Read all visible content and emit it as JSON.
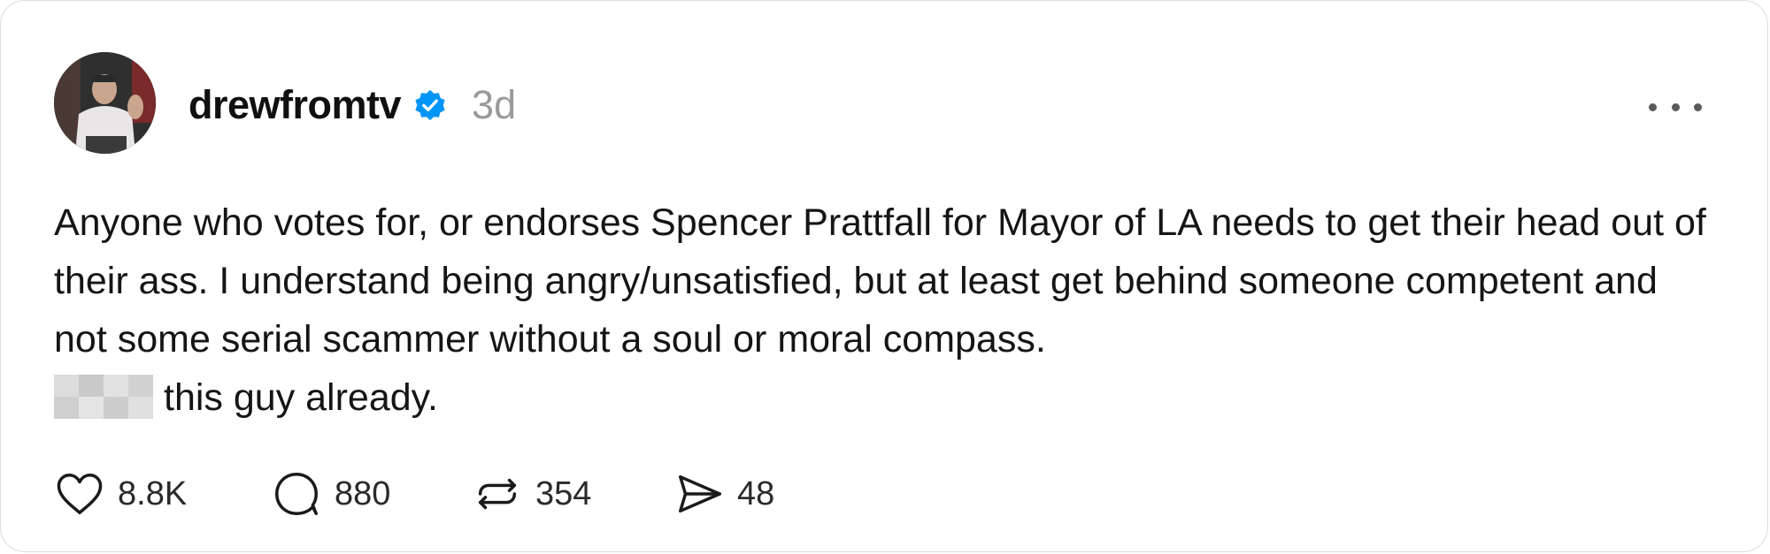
{
  "post": {
    "username": "drewfromtv",
    "verified": true,
    "timestamp": "3d",
    "body_main": "Anyone who votes for, or endorses Spencer Prattfall for Mayor of LA needs to get their head out of their ass. I understand being angry/unsatisfied, but at least get behind someone competent and not some serial scammer without a soul or moral compass.",
    "body_tail": "this guy already.",
    "censored_word": true
  },
  "actions": {
    "likes": "8.8K",
    "comments": "880",
    "reposts": "354",
    "shares": "48"
  },
  "icons": {
    "avatar": "profile-photo",
    "verified": "verified-badge-icon",
    "more": "more-options-icon",
    "like": "heart-icon",
    "comment": "comment-bubble-icon",
    "repost": "repost-icon",
    "share": "send-icon"
  },
  "colors": {
    "verified_blue": "#0095f6",
    "timestamp_gray": "#9a9a9a",
    "text": "#151515"
  }
}
